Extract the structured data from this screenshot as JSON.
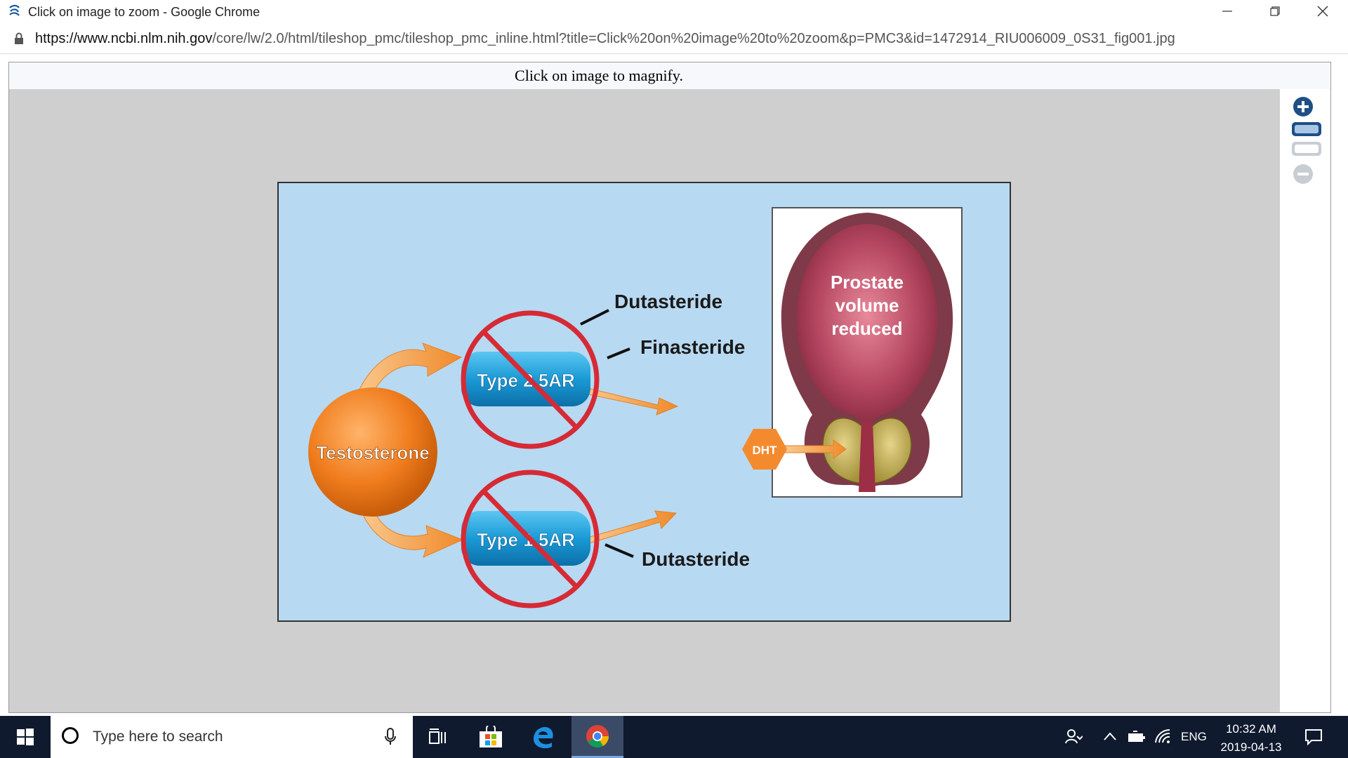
{
  "window": {
    "title": "Click on image to zoom - Google Chrome"
  },
  "address": {
    "url_domain": "https://www.ncbi.nlm.nih.gov",
    "url_path": "/core/lw/2.0/html/tileshop_pmc/tileshop_pmc_inline.html?title=Click%20on%20image%20to%20zoom&p=PMC3&id=1472914_RIU006009_0S31_fig001.jpg"
  },
  "viewer": {
    "caption": "Click on image to magnify.",
    "zoom_controls": [
      "zoom-in",
      "zoom-level-1",
      "zoom-level-2",
      "zoom-out"
    ]
  },
  "figure": {
    "testosterone_label": "Testosterone",
    "type2_label": "Type 2 5AR",
    "type1_label": "Type 1 5AR",
    "dutasteride_top": "Dutasteride",
    "finasteride": "Finasteride",
    "dutasteride_bottom": "Dutasteride",
    "dht_label": "DHT",
    "prostate_line1": "Prostate",
    "prostate_line2": "volume",
    "prostate_line3": "reduced"
  },
  "taskbar": {
    "search_placeholder": "Type here to search",
    "language": "ENG",
    "time": "10:32 AM",
    "date": "2019-04-13"
  },
  "colors": {
    "figure_background": "#b8d9f2",
    "testosterone_orange": "#f07d1e",
    "enzyme_blue": "#1a9ad6",
    "prohibition_red": "#d62a35",
    "prostate_maroon": "#a83a4e"
  }
}
